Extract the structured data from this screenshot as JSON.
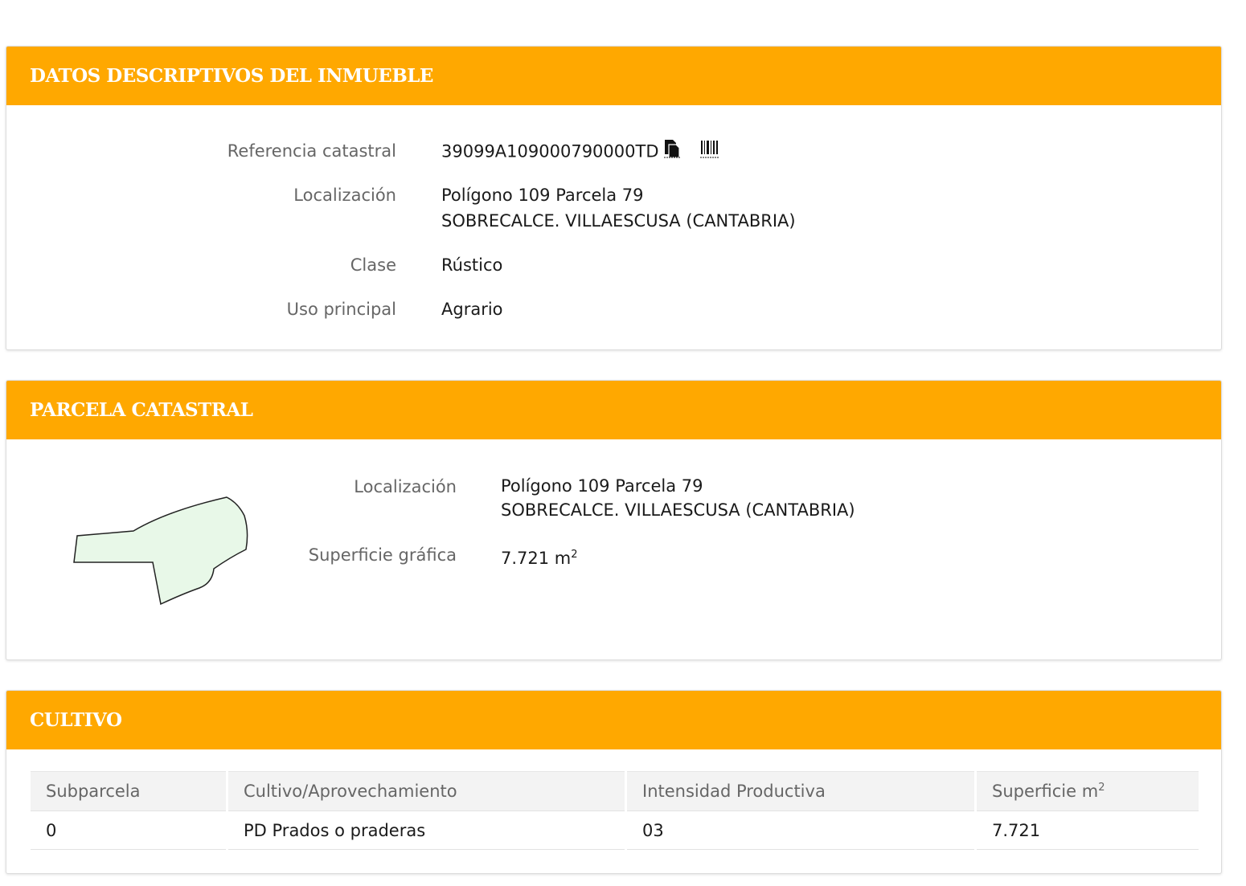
{
  "section1": {
    "title": "DATOS DESCRIPTIVOS DEL INMUEBLE",
    "ref_label": "Referencia catastral",
    "ref_value": "39099A109000790000TD",
    "copy_icon": "copy-document-icon",
    "barcode_icon": "barcode-icon",
    "loc_label": "Localización",
    "loc_line1": "Polígono 109 Parcela 79",
    "loc_line2": "SOBRECALCE. VILLAESCUSA (CANTABRIA)",
    "clase_label": "Clase",
    "clase_value": "Rústico",
    "uso_label": "Uso principal",
    "uso_value": "Agrario"
  },
  "section2": {
    "title": "PARCELA CATASTRAL",
    "loc_label": "Localización",
    "loc_line1": "Polígono 109 Parcela 79",
    "loc_line2": "SOBRECALCE. VILLAESCUSA (CANTABRIA)",
    "sup_label": "Superficie gráfica",
    "sup_value": "7.721 m",
    "sup_unit_exp": "2",
    "parcel_fill": "#e8f8e8"
  },
  "section3": {
    "title": "CULTIVO",
    "headers": [
      "Subparcela",
      "Cultivo/Aprovechamiento",
      "Intensidad Productiva",
      "Superficie m"
    ],
    "header_exp": "2",
    "rows": [
      [
        "0",
        "PD Prados o praderas",
        "03",
        "7.721"
      ]
    ]
  },
  "colors": {
    "header_bg": "#ffa800",
    "header_text": "#ffffff",
    "label": "#666666"
  }
}
